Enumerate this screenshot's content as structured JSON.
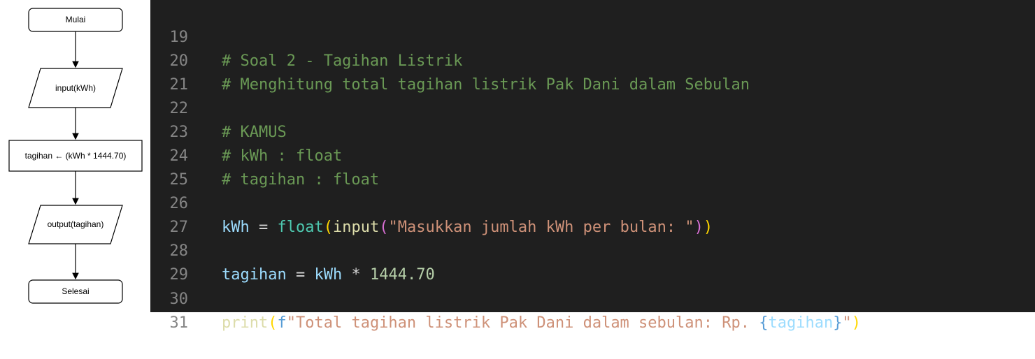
{
  "flowchart": {
    "start": "Mulai",
    "input": "input(kWh)",
    "process": "tagihan ← (kWh * 1444.70)",
    "output": "output(tagihan)",
    "end": "Selesai"
  },
  "editor": {
    "colors": {
      "background": "#1f1f1f",
      "line_number": "#858585",
      "comment": "#6a9955",
      "variable": "#9cdcfe",
      "builtin": "#4ec9b0",
      "function": "#dcdcaa",
      "string": "#ce9178",
      "number": "#b5cea8",
      "keyword": "#569cd6"
    },
    "lines": [
      {
        "num": "19",
        "comment": "# Soal 2 - Tagihan Listrik"
      },
      {
        "num": "20",
        "comment": "# Menghitung total tagihan listrik Pak Dani dalam Sebulan"
      },
      {
        "num": "21"
      },
      {
        "num": "22",
        "comment": "# KAMUS"
      },
      {
        "num": "23",
        "comment": "# kWh : float"
      },
      {
        "num": "24",
        "comment": "# tagihan : float"
      },
      {
        "num": "25"
      },
      {
        "num": "26",
        "var": "kWh",
        "op": " = ",
        "builtin": "float",
        "p1_open": "(",
        "func": "input",
        "p2_open": "(",
        "str": "\"Masukkan jumlah kWh per bulan: \"",
        "p2_close": ")",
        "p1_close": ")"
      },
      {
        "num": "27"
      },
      {
        "num": "28",
        "var": "tagihan",
        "op": " = ",
        "var2": "kWh",
        "op2": " * ",
        "number": "1444.70"
      },
      {
        "num": "29"
      },
      {
        "num": "30",
        "func": "print",
        "p1_open": "(",
        "fprefix": "f",
        "str1": "\"Total tagihan listrik Pak Dani dalam sebulan: Rp. ",
        "brace_open": "{",
        "var": "tagihan",
        "brace_close": "}",
        "str2": "\"",
        "p1_close": ")"
      },
      {
        "num": "31"
      }
    ]
  }
}
